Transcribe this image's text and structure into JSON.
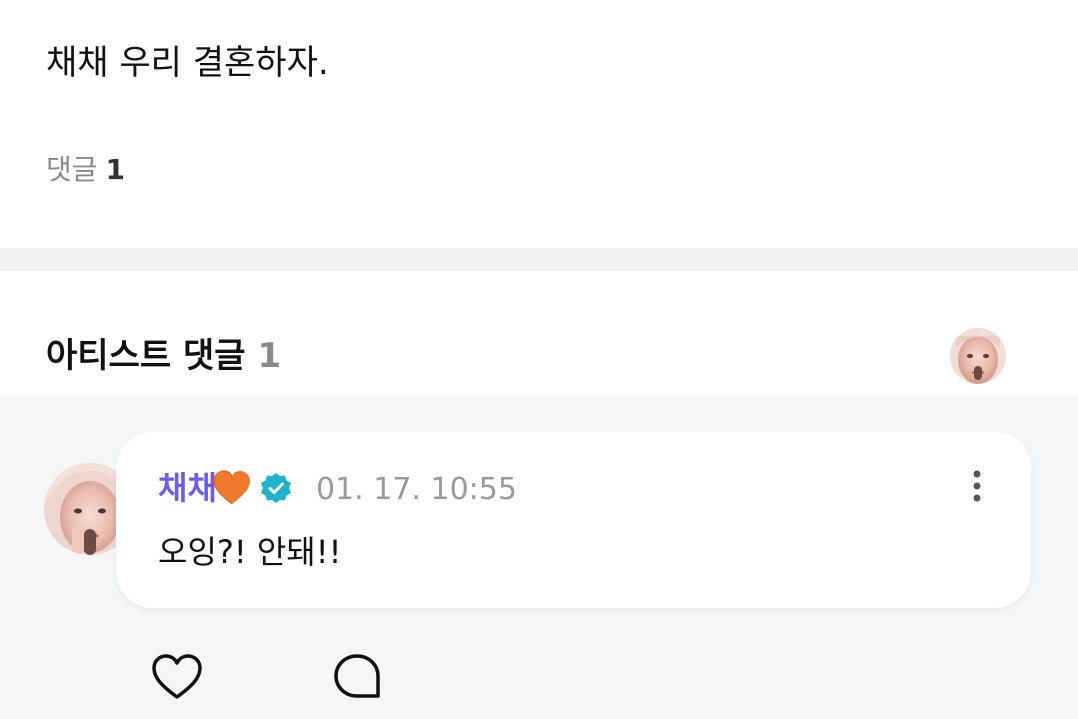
{
  "post": {
    "body": "채채 우리 결혼하자.",
    "comment_label": "댓글",
    "comment_count": "1"
  },
  "artist_comments": {
    "title": "아티스트 댓글",
    "count": "1"
  },
  "comment": {
    "author": "채채",
    "author_emoji": "orange-heart-icon",
    "verified_icon": "verified-badge-icon",
    "timestamp": "01. 17. 10:55",
    "text": "오잉?! 안돼!!"
  },
  "actions": {
    "like_icon": "heart-outline-icon",
    "reply_icon": "speech-bubble-icon",
    "more_icon": "kebab-menu-icon"
  },
  "colors": {
    "author": "#6a5cf0",
    "verified": "#1cb5c9",
    "heart": "#f07a2c",
    "section_bg": "#f5f6f8"
  }
}
